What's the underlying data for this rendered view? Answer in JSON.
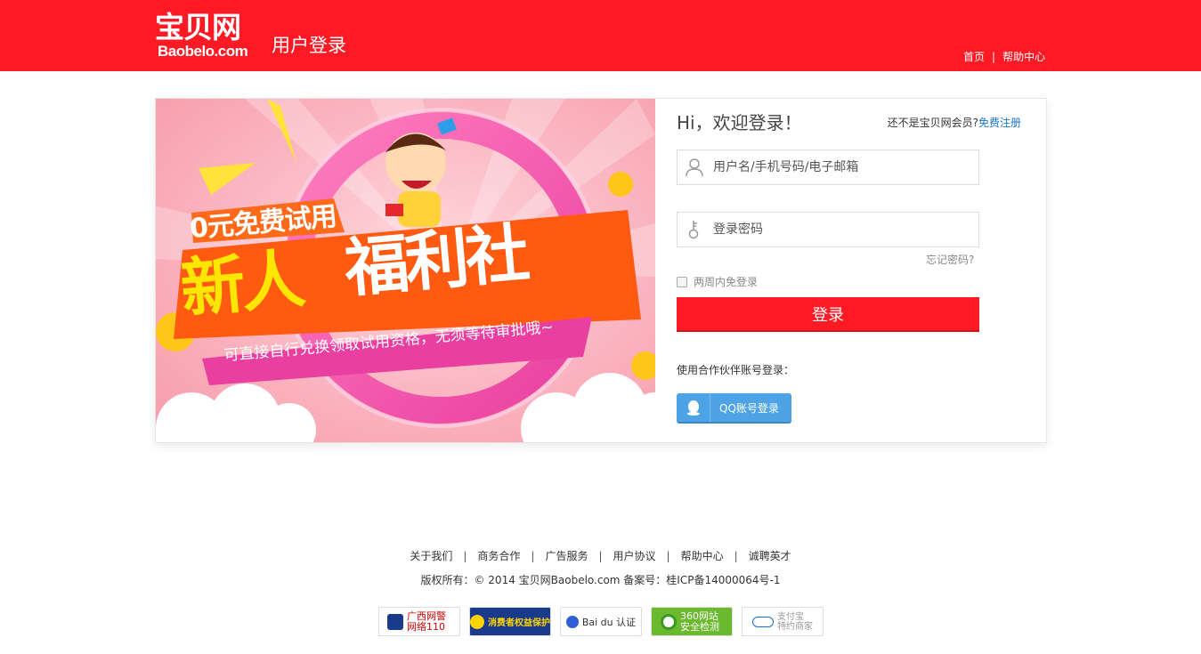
{
  "header": {
    "logo_cn": "宝贝网",
    "logo_en": "Baobelo.com",
    "page_label": "用户登录",
    "nav": [
      {
        "label": "首页"
      },
      {
        "label": "帮助中心"
      }
    ],
    "bg_color": "#fe1a24"
  },
  "banner": {
    "line1": "0元免费试用",
    "line2a": "新人",
    "line2b": "福利社",
    "subline": "可直接自行兑换领取试用资格，无须等待审批哦~"
  },
  "form": {
    "greeting": "Hi，欢迎登录！",
    "register_prompt": "还不是宝贝网会员?",
    "register_link": "免费注册",
    "username_placeholder": "用户名/手机号码/电子邮箱",
    "password_placeholder": "登录密码",
    "forgot": "忘记密码?",
    "remember": "两周内免登录",
    "login_button": "登录",
    "partner_label": "使用合作伙伴账号登录：",
    "qq_button": "QQ账号登录",
    "accent_color": "#fe1a24",
    "link_color": "#1a73c7"
  },
  "footer": {
    "links": [
      {
        "label": "关于我们"
      },
      {
        "label": "商务合作"
      },
      {
        "label": "广告服务"
      },
      {
        "label": "用户协议"
      },
      {
        "label": "帮助中心"
      },
      {
        "label": "诚聘英才"
      }
    ],
    "copyright": "版权所有：© 2014 宝贝网Baobelo.com 备案号：桂ICP备14000064号-1",
    "badges": [
      {
        "icon": "police-icon",
        "text": "广西网警 网络110"
      },
      {
        "icon": "consumer-rights-icon",
        "text": "消费者权益保护"
      },
      {
        "icon": "baidu-icon",
        "text": "Bai du 认证"
      },
      {
        "icon": "shield-360-icon",
        "text": "360网站 安全检测"
      },
      {
        "icon": "alipay-icon",
        "text": "支付宝 特约商家"
      }
    ]
  }
}
